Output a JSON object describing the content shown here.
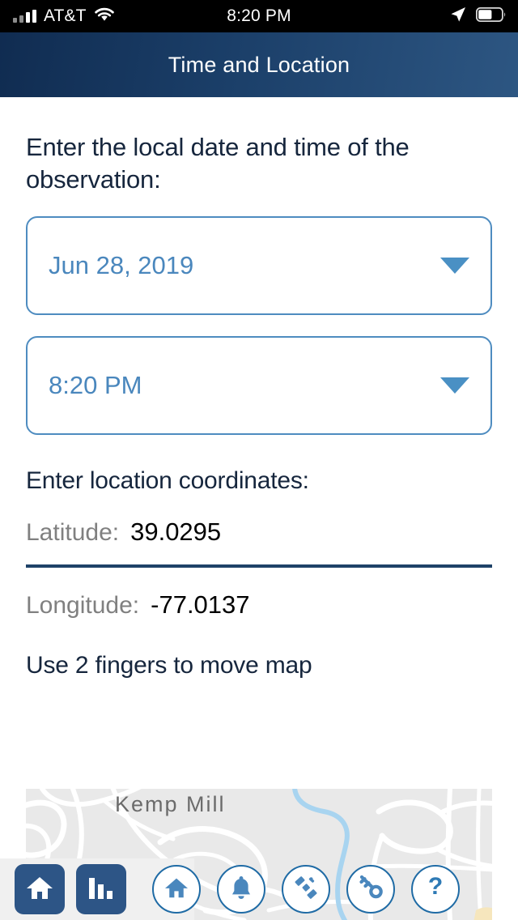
{
  "statusbar": {
    "carrier": "AT&T",
    "time": "8:20 PM",
    "signal_icon": "signal-bars-icon",
    "wifi_icon": "wifi-icon",
    "location_icon": "location-arrow-icon",
    "battery_icon": "battery-icon",
    "battery_level_pct": 55
  },
  "header": {
    "title": "Time and Location",
    "gradient_from": "#102c51",
    "gradient_to": "#2d5682"
  },
  "main": {
    "datetime_prompt": "Enter the local date and time of the observation:",
    "date_dropdown": {
      "value": "Jun 28, 2019",
      "caret_icon": "chevron-down-icon"
    },
    "time_dropdown": {
      "value": "8:20 PM",
      "caret_icon": "chevron-down-icon"
    },
    "coordinates_prompt": "Enter location coordinates:",
    "latitude": {
      "label": "Latitude:",
      "value": "39.0295"
    },
    "longitude": {
      "label": "Longitude:",
      "value": "-77.0137"
    },
    "map_hint": "Use 2 fingers to move map",
    "map": {
      "place_label": "Kemp Mill"
    }
  },
  "toolbar": {
    "buttons": [
      {
        "name": "home-button",
        "icon": "home-icon",
        "style": "filled"
      },
      {
        "name": "chart-button",
        "icon": "bar-chart-icon",
        "style": "filled"
      },
      {
        "name": "home-circle-button",
        "icon": "home-icon",
        "style": "outline"
      },
      {
        "name": "alerts-button",
        "icon": "bell-icon",
        "style": "outline"
      },
      {
        "name": "satellite-button",
        "icon": "satellite-icon",
        "style": "outline"
      },
      {
        "name": "key-button",
        "icon": "key-icon",
        "style": "outline"
      },
      {
        "name": "help-button",
        "icon": "question-mark-icon",
        "style": "outline"
      }
    ]
  },
  "colors": {
    "accent_blue": "#4a87bd",
    "border_blue": "#4e8cc0",
    "navy": "#16263d",
    "toolbar_blue": "#2d5586",
    "circle_blue": "#1f6ba5",
    "divider": "#1e4268"
  }
}
